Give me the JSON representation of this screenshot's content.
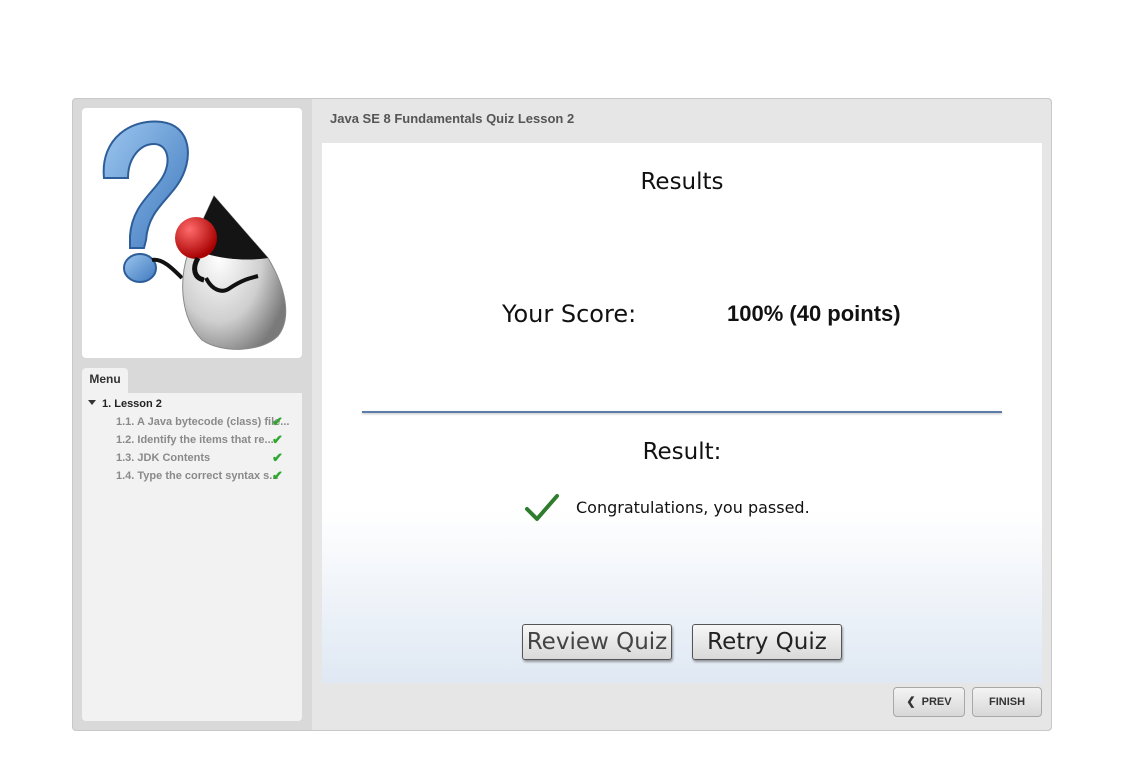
{
  "course": {
    "title": "Java SE 8 Fundamentals Quiz Lesson 2"
  },
  "sidebar": {
    "menu_tab": "Menu",
    "lesson": "1. Lesson 2",
    "items": [
      {
        "label": "1.1. A Java bytecode (class) file...",
        "status_icon": "check-icon"
      },
      {
        "label": "1.2. Identify the items that re...",
        "status_icon": "check-icon"
      },
      {
        "label": "1.3. JDK Contents",
        "status_icon": "check-icon"
      },
      {
        "label": "1.4. Type the correct syntax s...",
        "status_icon": "check-icon"
      }
    ]
  },
  "results": {
    "title": "Results",
    "score_label": "Your Score:",
    "score_value": "100% (40 points)",
    "result_label": "Result:",
    "message": "Congratulations, you passed.",
    "review_button": "Review Quiz",
    "retry_button": "Retry Quiz"
  },
  "nav": {
    "prev": "PREV",
    "finish": "FINISH"
  },
  "colors": {
    "divider": "#5d7ca8",
    "check": "#2ea82e",
    "pass_check": "#2e7d2e"
  }
}
